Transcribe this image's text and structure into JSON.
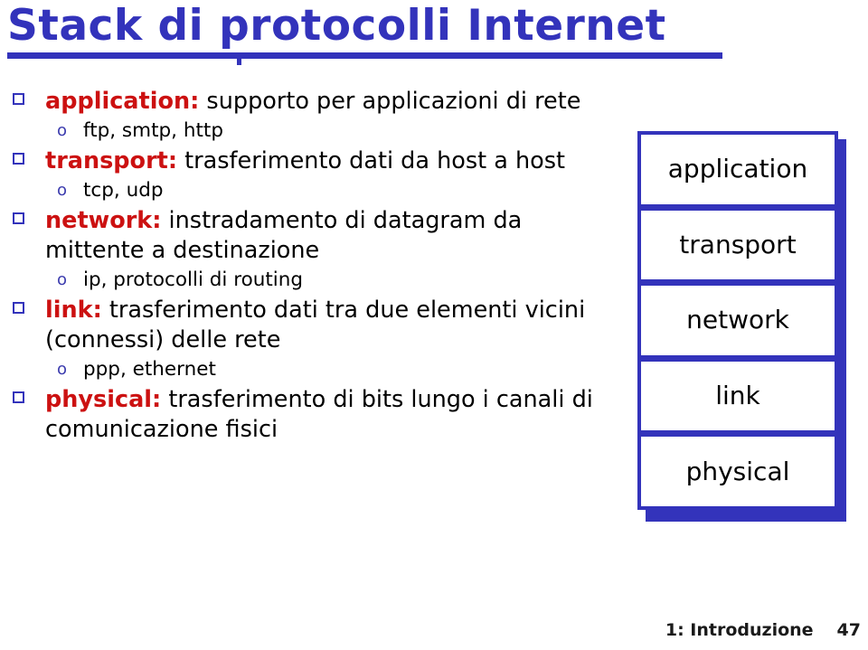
{
  "slide": {
    "title": "Stack di protocolli Internet",
    "title_color": "#3333BB",
    "keyword_color": "#CC1111",
    "body_color": "#000000",
    "bullet_marker_color": "#3333BB",
    "sub_marker_color": "#3B3BAE",
    "sub_marker_glyph": "o"
  },
  "bullets": [
    {
      "keyword": "application:",
      "text": " supporto per applicazioni di rete",
      "sub_items": [
        {
          "text": "ftp, smtp, http"
        }
      ]
    },
    {
      "keyword": "transport:",
      "text": " trasferimento dati da host a host",
      "sub_items": [
        {
          "text": "tcp, udp"
        }
      ]
    },
    {
      "keyword": "network:",
      "text": " instradamento di datagram da mittente a destinazione",
      "sub_items": [
        {
          "text": "ip, protocolli di routing"
        }
      ]
    },
    {
      "keyword": "link:",
      "text": " trasferimento dati tra due elementi vicini (connessi) delle rete",
      "sub_items": [
        {
          "text": "ppp, ethernet"
        }
      ]
    },
    {
      "keyword": "physical:",
      "text": " trasferimento di bits lungo i canali di comunicazione fisici",
      "sub_items": []
    }
  ],
  "protocol_stack": {
    "border_color": "#3333BB",
    "fill_color": "#FFFFFF",
    "layers": [
      {
        "label": "application"
      },
      {
        "label": "transport"
      },
      {
        "label": "network"
      },
      {
        "label": "link"
      },
      {
        "label": "physical"
      }
    ]
  },
  "footer": {
    "section": "1: Introduzione",
    "page": "47"
  }
}
